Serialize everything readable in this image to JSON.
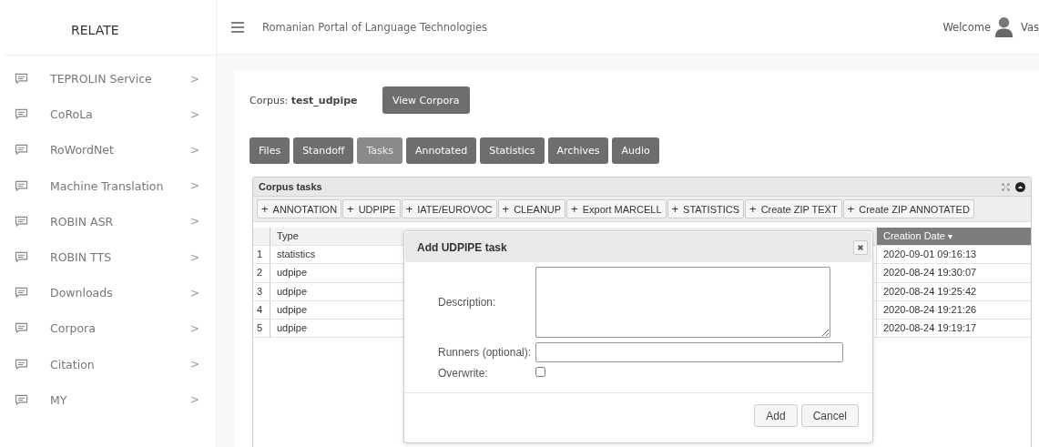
{
  "sidebar": {
    "brand": "RELATE",
    "items": [
      {
        "label": "TEPROLIN Service",
        "chevron": ">"
      },
      {
        "label": "CoRoLa",
        "chevron": ">"
      },
      {
        "label": "RoWordNet",
        "chevron": ">"
      },
      {
        "label": "Machine Translation",
        "chevron": ">"
      },
      {
        "label": "ROBIN ASR",
        "chevron": ">"
      },
      {
        "label": "ROBIN TTS",
        "chevron": ">"
      },
      {
        "label": "Downloads",
        "chevron": ">"
      },
      {
        "label": "Corpora",
        "chevron": ">"
      },
      {
        "label": "Citation",
        "chevron": ">"
      },
      {
        "label": "MY",
        "chevron": ">"
      }
    ]
  },
  "topbar": {
    "title": "Romanian Portal of Language Technologies",
    "welcome": "Welcome",
    "user": "Vas"
  },
  "corpus": {
    "label": "Corpus:",
    "name": "test_udpipe",
    "view_button": "View Corpora"
  },
  "tabs": [
    {
      "label": "Files",
      "selected": false
    },
    {
      "label": "Standoff",
      "selected": false
    },
    {
      "label": "Tasks",
      "selected": true
    },
    {
      "label": "Annotated",
      "selected": false
    },
    {
      "label": "Statistics",
      "selected": false
    },
    {
      "label": "Archives",
      "selected": false
    },
    {
      "label": "Audio",
      "selected": false
    }
  ],
  "grid": {
    "caption": "Corpus tasks",
    "toolbar": [
      {
        "icon": "+",
        "label": "ANNOTATION"
      },
      {
        "icon": "+",
        "label": "UDPIPE"
      },
      {
        "icon": "+",
        "label": "IATE/EUROVOC"
      },
      {
        "icon": "+",
        "label": "CLEANUP"
      },
      {
        "icon": "+",
        "label": "Export MARCELL"
      },
      {
        "icon": "+",
        "label": "STATISTICS"
      },
      {
        "icon": "+",
        "label": "Create ZIP TEXT"
      },
      {
        "icon": "+",
        "label": "Create ZIP ANNOTATED"
      }
    ],
    "columns": {
      "type": "Type",
      "date": "Creation Date",
      "sort_icon": "▾"
    },
    "rows": [
      {
        "num": "1",
        "type": "statistics",
        "date": "2020-09-01 09:16:13"
      },
      {
        "num": "2",
        "type": "udpipe",
        "date": "2020-08-24 19:30:07"
      },
      {
        "num": "3",
        "type": "udpipe",
        "date": "2020-08-24 19:25:42"
      },
      {
        "num": "4",
        "type": "udpipe",
        "date": "2020-08-24 19:21:26"
      },
      {
        "num": "5",
        "type": "udpipe",
        "date": "2020-08-24 19:19:17"
      }
    ]
  },
  "dialog": {
    "title": "Add UDPIPE task",
    "description_label": "Description:",
    "runners_label": "Runners (optional):",
    "overwrite_label": "Overwrite:",
    "overwrite_checked": false,
    "buttons": [
      "Add",
      "Cancel"
    ]
  }
}
